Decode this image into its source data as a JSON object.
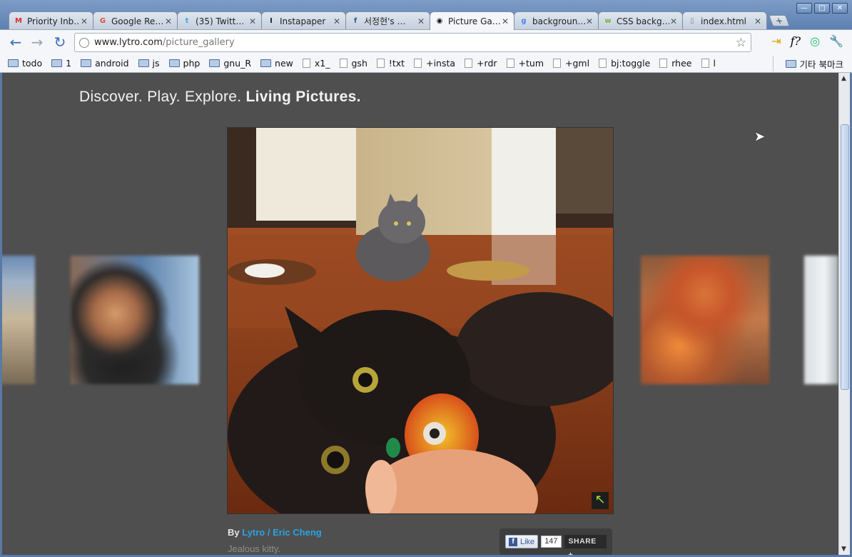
{
  "window": {
    "controls": [
      "—",
      "□",
      "✕"
    ]
  },
  "tabs": [
    {
      "title": "Priority Inb…",
      "icon": "gmail-icon",
      "color": "#d93025",
      "glyph": "M",
      "active": false
    },
    {
      "title": "Google Re…",
      "icon": "google-reader-icon",
      "color": "#dd4b39",
      "glyph": "G",
      "active": false
    },
    {
      "title": "(35) Twitt…",
      "icon": "twitter-icon",
      "color": "#4aa3df",
      "glyph": "t",
      "active": false
    },
    {
      "title": "Instapaper",
      "icon": "instapaper-icon",
      "color": "#222222",
      "glyph": "I",
      "active": false
    },
    {
      "title": "서정현's …",
      "icon": "facebook-icon",
      "color": "#3b5998",
      "glyph": "f",
      "active": false
    },
    {
      "title": "Picture Ga…",
      "icon": "lytro-icon",
      "color": "#111111",
      "glyph": "◉",
      "active": true
    },
    {
      "title": "backgroun…",
      "icon": "google-search-icon",
      "color": "#4285f4",
      "glyph": "g",
      "active": false
    },
    {
      "title": "CSS backg…",
      "icon": "w3-icon",
      "color": "#7cb342",
      "glyph": "w",
      "active": false
    },
    {
      "title": "index.html",
      "icon": "page-icon",
      "color": "#888888",
      "glyph": "▯",
      "active": false
    }
  ],
  "toolbar": {
    "back": "←",
    "forward": "→",
    "reload": "↻",
    "url_host": "www.lytro.com",
    "url_path": "/picture_gallery",
    "star": "☆",
    "ext_icons": [
      "⇥",
      "f?",
      "◎",
      "🔧"
    ]
  },
  "bookmarks": [
    {
      "label": "todo",
      "type": "folder"
    },
    {
      "label": "1",
      "type": "folder"
    },
    {
      "label": "android",
      "type": "folder"
    },
    {
      "label": "js",
      "type": "folder"
    },
    {
      "label": "php",
      "type": "folder"
    },
    {
      "label": "gnu_R",
      "type": "folder"
    },
    {
      "label": "new",
      "type": "folder"
    },
    {
      "label": "x1_",
      "type": "page"
    },
    {
      "label": "gsh",
      "type": "page"
    },
    {
      "label": "!txt",
      "type": "page"
    },
    {
      "label": "+insta",
      "type": "page"
    },
    {
      "label": "+rdr",
      "type": "page"
    },
    {
      "label": "+tum",
      "type": "page"
    },
    {
      "label": "+gml",
      "type": "page"
    },
    {
      "label": "bj:toggle",
      "type": "page"
    },
    {
      "label": "rhee",
      "type": "page"
    },
    {
      "label": "l",
      "type": "page"
    }
  ],
  "other_bookmarks": "기타 북마크",
  "page": {
    "tagline_plain": "Discover. Play. Explore. ",
    "tagline_bold": "Living Pictures.",
    "by_label": "By ",
    "author": "Lytro / Eric Cheng",
    "description": "Jealous kitty.",
    "expand_glyph": "↖"
  },
  "social": {
    "like_label": "Like",
    "like_count": "147",
    "share_label": "SHARE +"
  }
}
